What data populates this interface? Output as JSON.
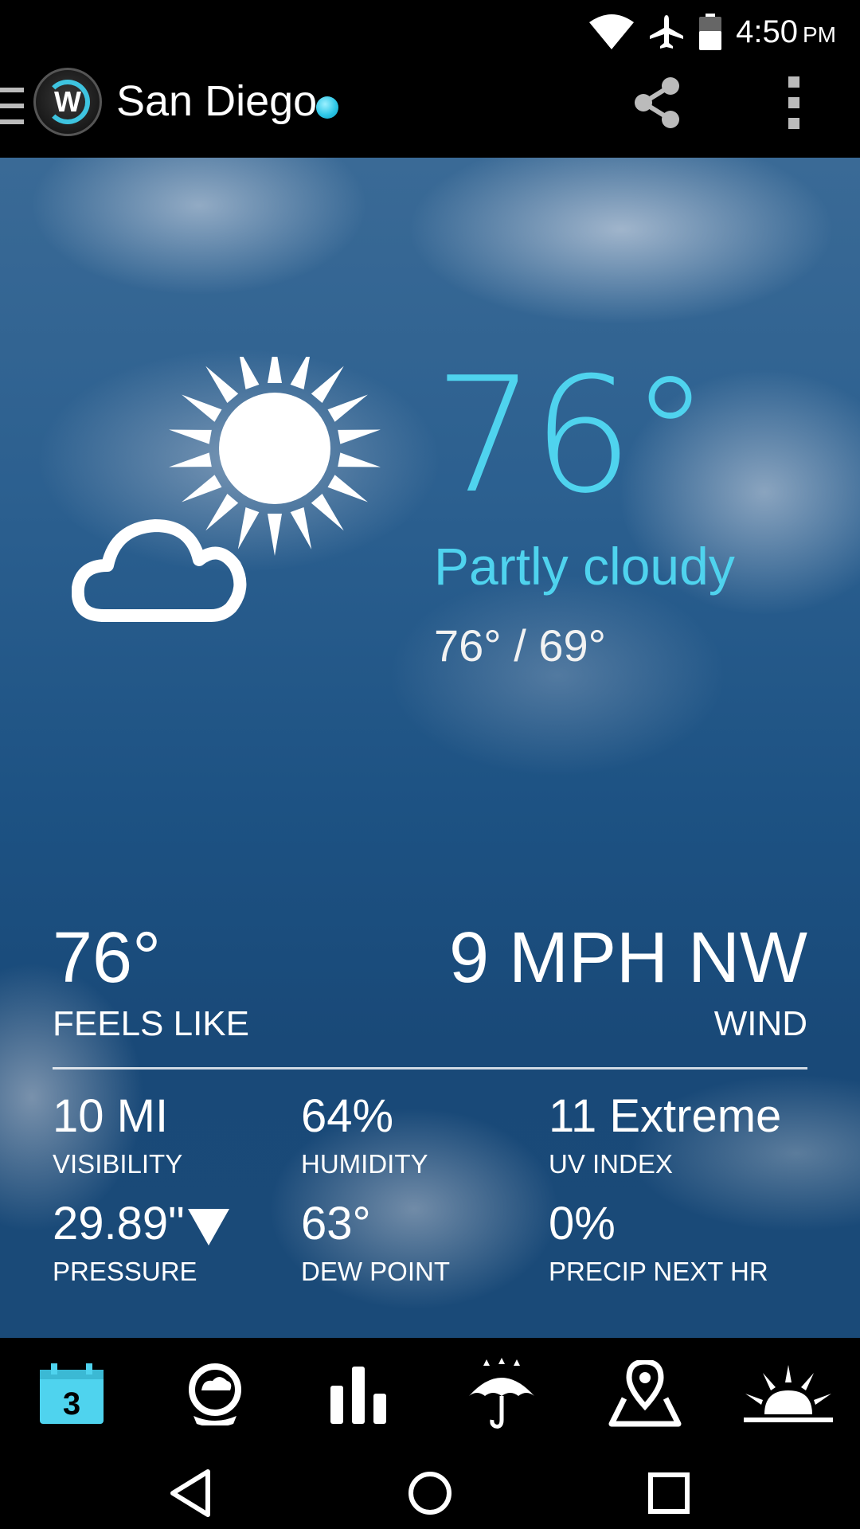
{
  "status_bar": {
    "time": "4:50",
    "ampm": "PM",
    "icons": [
      "wifi-icon",
      "airplane-icon",
      "battery-icon"
    ]
  },
  "app_bar": {
    "logo_text": "W",
    "city": "San Diego",
    "actions": [
      "share-icon",
      "overflow-menu-icon"
    ]
  },
  "current": {
    "icon": "partly-cloudy-icon",
    "temperature": "76°",
    "condition": "Partly cloudy",
    "hi_lo": "76° / 69°"
  },
  "details": {
    "feels_like": {
      "value": "76°",
      "label": "FEELS LIKE"
    },
    "wind": {
      "value": "9 MPH NW",
      "label": "WIND"
    },
    "stats": [
      {
        "value": "10 MI",
        "label": "VISIBILITY"
      },
      {
        "value": "64%",
        "label": "HUMIDITY"
      },
      {
        "value": "11 Extreme",
        "label": "UV INDEX"
      },
      {
        "value": "29.89\"",
        "label": "PRESSURE",
        "trend": "falling"
      },
      {
        "value": "63°",
        "label": "DEW POINT"
      },
      {
        "value": "0%",
        "label": "PRECIP NEXT HR"
      }
    ]
  },
  "tabs": [
    {
      "icon": "calendar-icon",
      "badge": "3",
      "active": true
    },
    {
      "icon": "radar-globe-icon"
    },
    {
      "icon": "bar-chart-icon"
    },
    {
      "icon": "umbrella-rain-icon"
    },
    {
      "icon": "map-pin-icon"
    },
    {
      "icon": "sunrise-icon"
    }
  ],
  "nav": [
    "back-icon",
    "home-icon",
    "recents-icon"
  ],
  "colors": {
    "accent": "#4fd3ee",
    "background": "#000000",
    "sky_dark": "#194978"
  }
}
